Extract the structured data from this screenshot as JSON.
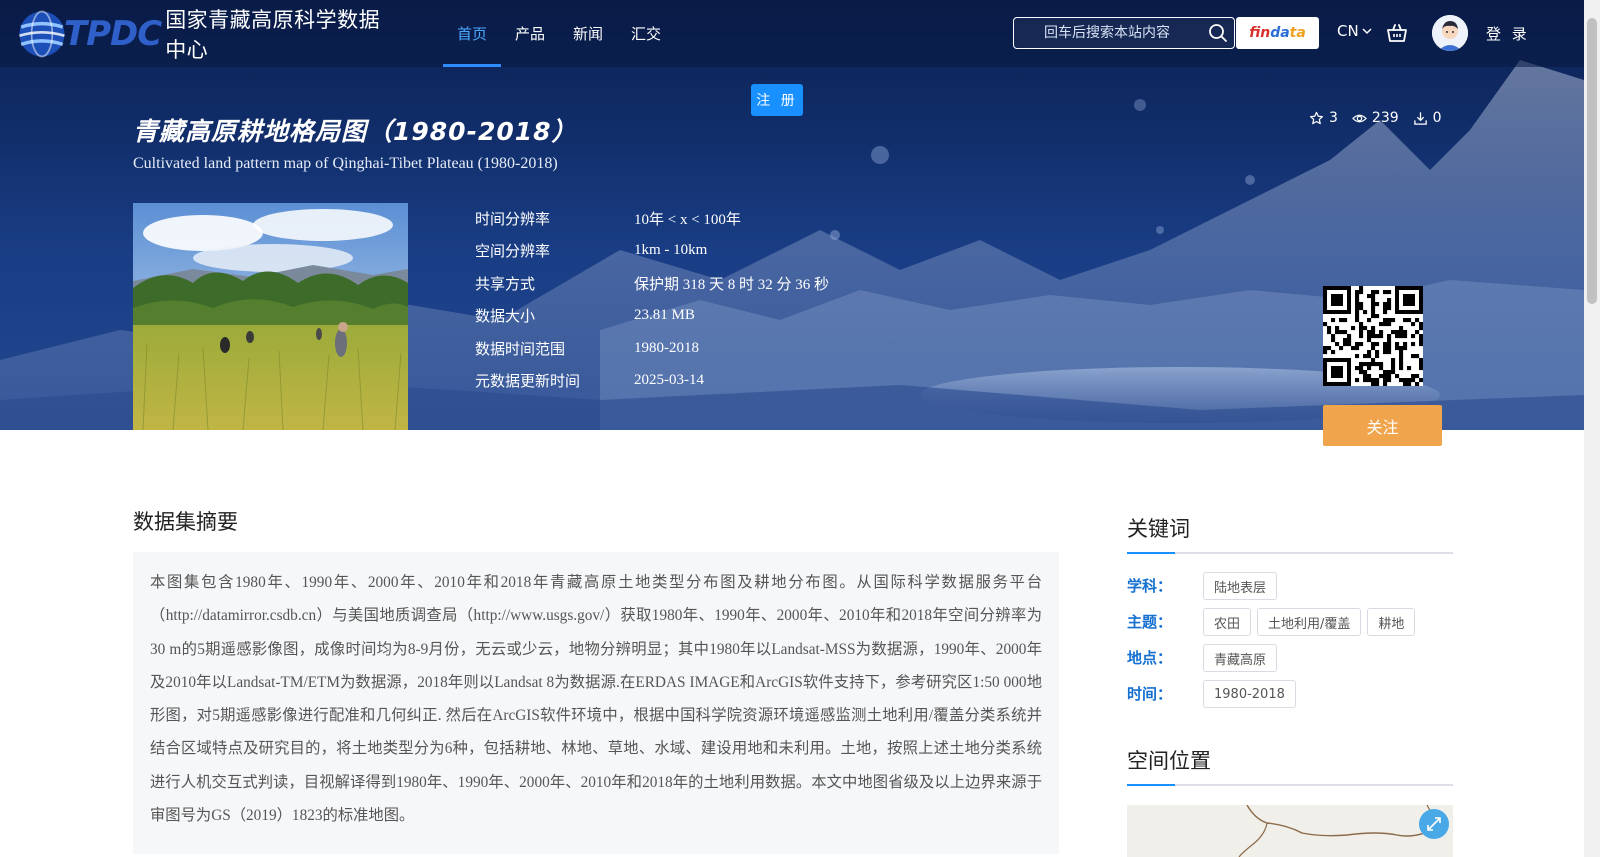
{
  "brand": {
    "short": "TPDC",
    "full_cn": "国家青藏高原科学数据中心"
  },
  "nav": {
    "items": [
      {
        "label": "首页",
        "active": true
      },
      {
        "label": "产品"
      },
      {
        "label": "新闻"
      },
      {
        "label": "汇交"
      }
    ]
  },
  "search": {
    "placeholder": "回车后搜索本站内容"
  },
  "findata": {
    "part1": "fin",
    "part2": "da",
    "part3": "ta"
  },
  "lang": "CN",
  "login_label": "登 录",
  "register_label": "注 册",
  "dataset": {
    "title_cn": "青藏高原耕地格局图（1980-2018）",
    "title_en": "Cultivated land pattern map of Qinghai-Tibet Plateau (1980-2018)",
    "stats": {
      "stars": "3",
      "views": "239",
      "downloads": "0"
    },
    "meta": [
      {
        "key": "时间分辨率",
        "value": "10年 < x < 100年"
      },
      {
        "key": "空间分辨率",
        "value": "1km - 10km"
      },
      {
        "key": "共享方式",
        "value": "保护期 318 天 8 时 32 分 36 秒"
      },
      {
        "key": "数据大小",
        "value": "23.81 MB"
      },
      {
        "key": "数据时间范围",
        "value": "1980-2018"
      },
      {
        "key": "元数据更新时间",
        "value": "2025-03-14"
      }
    ],
    "follow_label": "关注"
  },
  "abstract": {
    "title": "数据集摘要",
    "text": "本图集包含1980年、1990年、2000年、2010年和2018年青藏高原土地类型分布图及耕地分布图。从国际科学数据服务平台（http://datamirror.csdb.cn）与美国地质调查局（http://www.usgs.gov/）获取1980年、1990年、2000年、2010年和2018年空间分辨率为30 m的5期遥感影像图，成像时间均为8-9月份，无云或少云，地物分辨明显；其中1980年以Landsat-MSS为数据源，1990年、2000年及2010年以Landsat-TM/ETM为数据源，2018年则以Landsat 8为数据源.在ERDAS IMAGE和ArcGIS软件支持下，参考研究区1:50 000地形图，对5期遥感影像进行配准和几何纠正. 然后在ArcGIS软件环境中，根据中国科学院资源环境遥感监测土地利用/覆盖分类系统并结合区域特点及研究目的，将土地类型分为6种，包括耕地、林地、草地、水域、建设用地和未利用。土地，按照上述土地分类系统进行人机交互式判读，目视解译得到1980年、1990年、2000年、2010年和2018年的土地利用数据。本文中地图省级及以上边界来源于审图号为GS（2019）1823的标准地图。"
  },
  "keywords": {
    "title": "关键词",
    "rows": [
      {
        "label": "学科：",
        "tags": [
          "陆地表层"
        ]
      },
      {
        "label": "主题：",
        "tags": [
          "农田",
          "土地利用/覆盖",
          "耕地"
        ]
      },
      {
        "label": "地点：",
        "tags": [
          "青藏高原"
        ]
      },
      {
        "label": "时间：",
        "tags": [
          "1980-2018"
        ]
      }
    ]
  },
  "location": {
    "title": "空间位置"
  },
  "colors": {
    "accent": "#1890ff",
    "follow": "#f0a44c",
    "keyword_label": "#1570d0",
    "hero": "#12306e"
  }
}
